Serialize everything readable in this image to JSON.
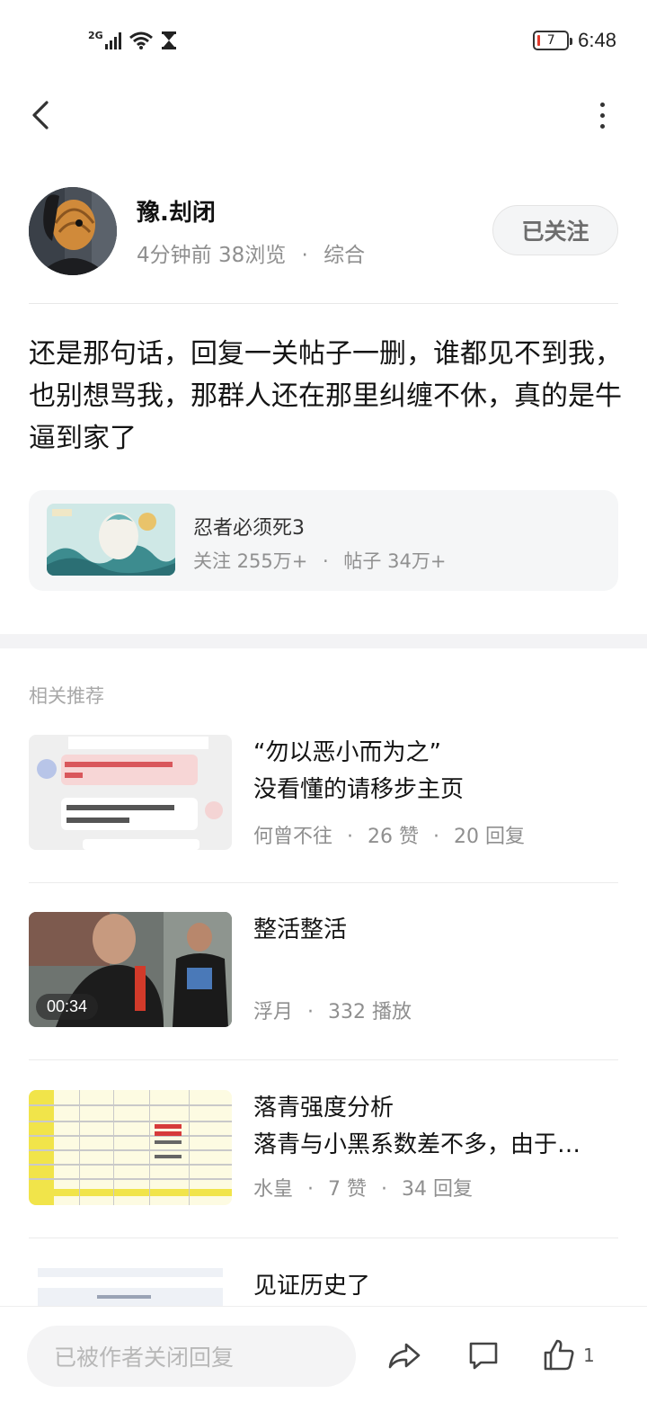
{
  "status_bar": {
    "network": "2G",
    "battery": "7",
    "time": "6:48"
  },
  "nav": {
    "back_icon": "chevron-left-icon",
    "more_icon": "more-vertical-icon"
  },
  "author": {
    "name": "豫.刦闭",
    "time_ago": "4分钟前",
    "views": "38浏览",
    "separator": "·",
    "category": "综合",
    "follow_label": "已关注"
  },
  "post": {
    "text": "还是那句话，回复一关帖子一删，谁都见不到我，也别想骂我，那群人还在那里纠缠不休，真的是牛逼到家了"
  },
  "forum": {
    "name": "忍者必须死3",
    "followers": "关注 255万+",
    "separator": "·",
    "posts": "帖子 34万+"
  },
  "recommend": {
    "title": "相关推荐",
    "items": [
      {
        "line1": "“勿以恶小而为之”",
        "line2": "没看懂的请移步主页",
        "author": "何曾不往",
        "stat1": "26 赞",
        "stat2": "20 回复"
      },
      {
        "line1": "整活整活",
        "line2": "",
        "author": "浮月",
        "stat1": "332 播放",
        "duration": "00:34"
      },
      {
        "line1": "落青强度分析",
        "line2": "落青与小黑系数差不多，由于…",
        "author": "水皇",
        "stat1": "7 赞",
        "stat2": "34 回复"
      },
      {
        "line1": "见证历史了"
      }
    ],
    "separator": "·"
  },
  "bottom_bar": {
    "reply_placeholder": "已被作者关闭回复",
    "like_count": "1",
    "icons": [
      "share-icon",
      "comment-icon",
      "thumbs-up-icon"
    ]
  },
  "colors": {
    "meta_gray": "#8f8f8f",
    "card_bg": "#f5f6f7",
    "battery_low": "#e23a2c"
  }
}
